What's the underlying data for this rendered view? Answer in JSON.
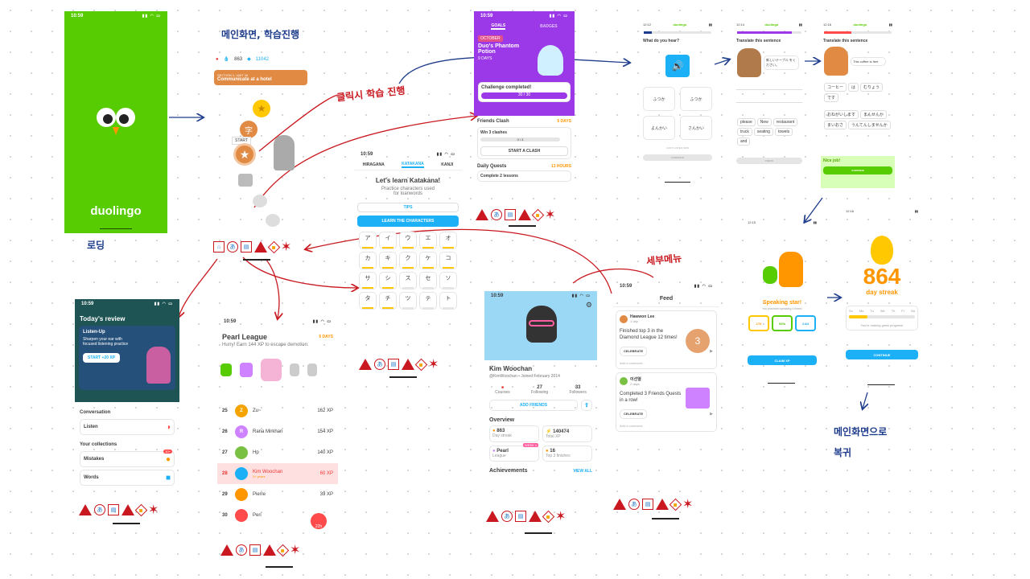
{
  "annotations": {
    "main_screen": "메인화면, 학습진행",
    "click_learn": "클릭시 학습 진행",
    "loading": "로딩",
    "detail_menu": "세부메뉴",
    "return_main": "메인화면으로 복귀"
  },
  "splash": {
    "time": "10:59",
    "brand": "duolingo"
  },
  "home": {
    "stat1": "863",
    "stat2": "11042",
    "section": "SECTION 1, UNIT 16",
    "unit": "Communicate at a hotel",
    "start": "START",
    "char": "字"
  },
  "goals": {
    "time": "10:59",
    "tab_goals": "GOALS",
    "tab_badges": "BADGES",
    "month": "OCTOBER",
    "title": "Duo's Phantom Potion",
    "days": "9 DAYS",
    "complete": "Challenge completed!",
    "progress": "30 / 30",
    "friends": "Friends Clash",
    "friends_days": "5 DAYS",
    "win": "Win 3 clashes",
    "win_prog": "0 / 3",
    "start_clash": "START A CLASH",
    "daily": "Daily Quests",
    "daily_hours": "13 HOURS",
    "lessons": "Complete 2 lessons"
  },
  "katakana": {
    "time": "10:59",
    "tabs": [
      "HIRAGANA",
      "KATAKANA",
      "KANJI"
    ],
    "title": "Let's learn Katakana!",
    "sub1": "Practice characters used",
    "sub2": "for loanwords",
    "tips": "TIPS",
    "learn": "LEARN THE CHARACTERS",
    "kana": [
      "ア",
      "イ",
      "ウ",
      "エ",
      "オ",
      "カ",
      "キ",
      "ク",
      "ケ",
      "コ",
      "サ",
      "シ",
      "ス",
      "セ",
      "ソ",
      "タ",
      "チ",
      "ツ",
      "テ",
      "ト"
    ]
  },
  "hear": {
    "time": "12:12",
    "brand": "duolingo",
    "prompt": "What do you hear?",
    "options": [
      "ふつか",
      "ふつか",
      "よんかい",
      "さんかい"
    ],
    "cant": "CAN'T LISTEN NOW",
    "check": "CONTINUE"
  },
  "translate1": {
    "time": "12:14",
    "brand": "duolingo",
    "prompt": "Translate this sentence",
    "bubble": "新しいテーブル をください。",
    "words": [
      "please",
      "New",
      "restaurant",
      "truck",
      "seating",
      "towels",
      "and"
    ],
    "check": "CHECK"
  },
  "translate2": {
    "time": "12:16",
    "brand": "duolingo",
    "prompt": "Translate this sentence",
    "bubble": "This coffee is free",
    "words": [
      "コーヒー",
      "は",
      "むりょう",
      "です"
    ],
    "words2": [
      "おねがいします",
      "まんせんか",
      "まいおさ",
      "うんてんしませんか"
    ],
    "nice": "Nice job!",
    "cont": "CONTINUE"
  },
  "review": {
    "time": "10:59",
    "title": "Today's review",
    "card": "Listen-Up",
    "desc": "Sharpen your ear with focused listening practice",
    "xp": "START +20 XP",
    "conv": "Conversation",
    "listen": "Listen",
    "coll": "Your collections",
    "mistakes": "Mistakes",
    "badge": "10+",
    "words": "Words"
  },
  "league": {
    "time": "10:59",
    "title": "Pearl League",
    "days": "5 DAYS",
    "sub": "Hurry! Earn 144 XP to escape demotion.",
    "rows": [
      {
        "rank": "25",
        "init": "Z",
        "name": "Zu~",
        "xp": "162 XP",
        "color": "#f5a300"
      },
      {
        "rank": "26",
        "init": "R",
        "name": "Rana Mirkhan",
        "xp": "154 XP",
        "color": "#ce82ff"
      },
      {
        "rank": "27",
        "init": "",
        "name": "Hp",
        "xp": "140 XP",
        "color": "#7ac143"
      },
      {
        "rank": "28",
        "init": "",
        "name": "Kim Woochan",
        "xp": "60 XP",
        "color": "#1cb0f6",
        "sub": "3+ years"
      },
      {
        "rank": "29",
        "init": "",
        "name": "Pierre",
        "xp": "39 XP",
        "color": "#ff9600"
      },
      {
        "rank": "30",
        "init": "",
        "name": "Peri",
        "xp": "",
        "color": "#ff4b4b"
      }
    ],
    "years": "3+ years",
    "badge": "22h"
  },
  "profile": {
    "time": "10:59",
    "name": "Kim Woochan",
    "handle": "@KimWoochan • Joined February 2014",
    "courses": "Courses",
    "following_n": "27",
    "following": "Following",
    "followers_n": "33",
    "followers": "Followers",
    "add": "ADD FRIENDS",
    "overview": "Overview",
    "s1": "863",
    "s1l": "Day streak",
    "s2": "140474",
    "s2l": "Total XP",
    "s3": "Pearl",
    "s3l": "League",
    "week": "WEEK 1",
    "s4": "16",
    "s4l": "Top 3 finishes",
    "ach": "Achievements",
    "view": "VIEW ALL"
  },
  "feed": {
    "time": "10:59",
    "title": "Feed",
    "p1name": "Hawwon Lee",
    "p1time": "1 day",
    "p1text": "Finished top 3 in the Diamond League 12 times!",
    "medal": "3",
    "celebrate": "CELEBRATE",
    "comment": "Add a comment...",
    "p2name": "이선열",
    "p2time": "2 days",
    "p2text": "Completed 3 Friends Quests in a row!"
  },
  "speaking": {
    "time": "12:15",
    "title": "Speaking star!",
    "sub": "You practiced speaking 4 times!",
    "b1": "176",
    "b2": "94%",
    "b3": "2:44",
    "claim": "CLAIM XP"
  },
  "streak": {
    "time": "12:16",
    "num": "864",
    "label": "day streak",
    "days": [
      "Su",
      "Mo",
      "Tu",
      "We",
      "Th",
      "Fr",
      "Sa"
    ],
    "msg": "You're making great progress!",
    "cont": "CONTINUE"
  },
  "colors": {
    "green": "#58cc02",
    "blue": "#1cb0f6",
    "purple": "#9b38e8",
    "red": "#c9181f",
    "navy": "#1e3c8c"
  }
}
